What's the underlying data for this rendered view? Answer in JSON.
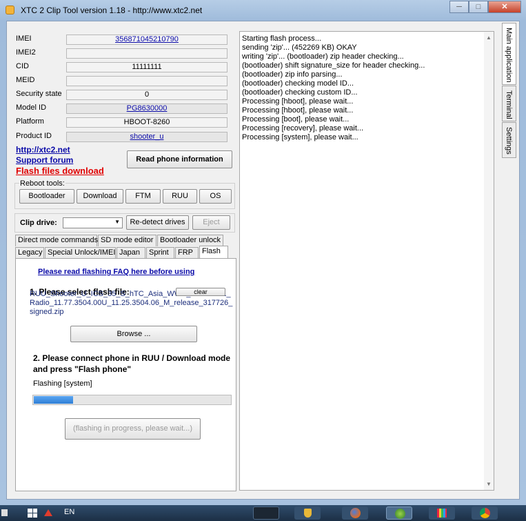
{
  "window": {
    "title": "XTC 2 Clip Tool version 1.18 - http://www.xtc2.net"
  },
  "window_controls": {
    "minimize": "─",
    "maximize": "□",
    "close": "✕"
  },
  "device_info": [
    {
      "label": "IMEI",
      "value": "356871045210790",
      "link": true,
      "grey": false
    },
    {
      "label": "IMEI2",
      "value": "",
      "link": false,
      "grey": false
    },
    {
      "label": "CID",
      "value": "11111111",
      "link": false,
      "grey": false
    },
    {
      "label": "MEID",
      "value": "",
      "link": false,
      "grey": false
    },
    {
      "label": "Security state",
      "value": "0",
      "link": false,
      "grey": false
    },
    {
      "label": "Model ID",
      "value": "PG8630000",
      "link": true,
      "grey": true
    },
    {
      "label": "Platform",
      "value": "HBOOT-8260",
      "link": false,
      "grey": false
    },
    {
      "label": "Product ID",
      "value": "shooter_u",
      "link": true,
      "grey": true
    }
  ],
  "links": {
    "site": "http://xtc2.net",
    "forum": "Support forum",
    "flash_download": "Flash files download"
  },
  "read_phone_button": "Read phone information",
  "reboot": {
    "label": "Reboot tools:",
    "buttons": [
      "Bootloader",
      "Download",
      "FTM",
      "RUU",
      "OS"
    ]
  },
  "clip_drive": {
    "label": "Clip drive:",
    "value": "",
    "redetect": "Re-detect drives",
    "eject": "Eject"
  },
  "tabs_row1": [
    "Direct mode commands",
    "SD mode editor",
    "Bootloader unlock"
  ],
  "tabs_row2": [
    "Legacy",
    "Special Unlock/IMEI",
    "Japan",
    "Sprint",
    "FRP",
    "Flash"
  ],
  "flash": {
    "faq_link": "Please read flashing FAQ here before using",
    "step1": "1. Please select flash file:",
    "file_text": "RUU_Shooter_U_ICS_35_S_hTC_Asia_WWE_3.28.707.1_Radio_11.77.3504.00U_11.25.3504.06_M_release_317726_signed.zip",
    "clear": "clear",
    "browse": "Browse ...",
    "step2": "2. Please connect phone in RUU / Download mode and press \"Flash phone\"",
    "status": "Flashing [system]",
    "progress": 0.2,
    "flash_button": "(flashing in progress, please wait...)"
  },
  "log": [
    "Starting flash process...",
    "sending 'zip'... (452269 KB) OKAY",
    "writing 'zip'... (bootloader) zip header checking...",
    "(bootloader) shift signature_size for header checking...",
    "(bootloader) zip info parsing...",
    "(bootloader) checking model ID...",
    "(bootloader) checking custom ID...",
    "Processing [hboot], please wait...",
    "Processing [hboot], please wait...",
    "Processing [boot], please wait...",
    "Processing [recovery], please wait...",
    "Processing [system], please wait..."
  ],
  "side_tabs": [
    "Main application",
    "Terminal",
    "Settings"
  ],
  "taskbar": {
    "language": "EN"
  },
  "colors": {
    "link": "#0a0aa8",
    "red_link": "#e00000",
    "progress": "#3a8ee6",
    "titlebar": "#b6cde6"
  }
}
